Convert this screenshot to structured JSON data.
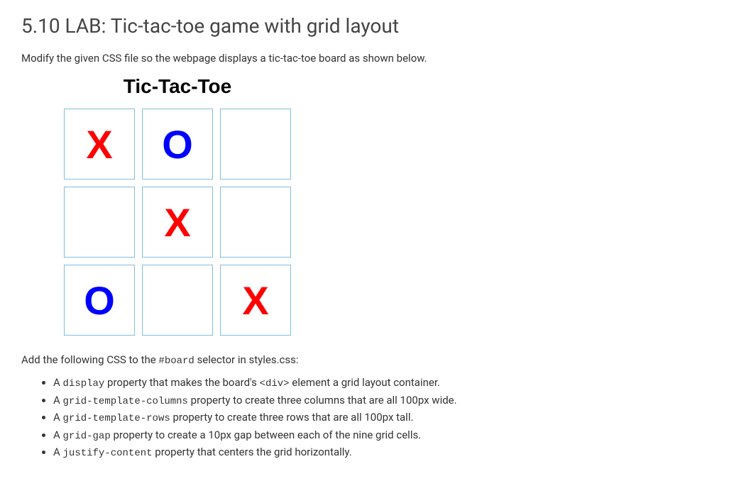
{
  "title": "5.10 LAB: Tic-tac-toe game with grid layout",
  "intro": "Modify the given CSS file so the webpage displays a tic-tac-toe board as shown below.",
  "figure": {
    "heading": "Tic-Tac-Toe",
    "cells": [
      "X",
      "O",
      "",
      "",
      "X",
      "",
      "O",
      "",
      "X"
    ]
  },
  "instruction_prefix": "Add the following CSS to the ",
  "instruction_code": "#board",
  "instruction_suffix": " selector in styles.css:",
  "bullets": [
    {
      "pre": "A ",
      "code": "display",
      "mid": " property that makes the board's ",
      "code2": "<div>",
      "post": " element a grid layout container."
    },
    {
      "pre": "A ",
      "code": "grid-template-columns",
      "mid": "",
      "code2": "",
      "post": " property to create three columns that are all 100px wide."
    },
    {
      "pre": "A ",
      "code": "grid-template-rows",
      "mid": "",
      "code2": "",
      "post": " property to create three rows that are all 100px tall."
    },
    {
      "pre": "A ",
      "code": "grid-gap",
      "mid": "",
      "code2": "",
      "post": " property to create a 10px gap between each of the nine grid cells."
    },
    {
      "pre": "A ",
      "code": "justify-content",
      "mid": "",
      "code2": "",
      "post": " property that centers the grid horizontally."
    }
  ]
}
